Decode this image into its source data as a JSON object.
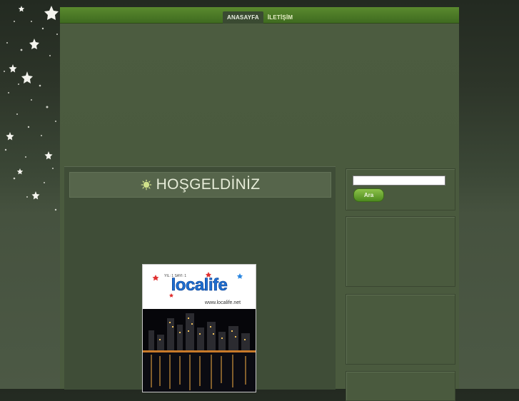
{
  "nav": {
    "items": [
      {
        "label": "ANASAYFA"
      },
      {
        "label": "İLETİŞİM"
      }
    ]
  },
  "content": {
    "title": "HOŞGELDİNİZ"
  },
  "banner": {
    "tagline": "YIL: 1 SAYI: 1",
    "brand": "localife",
    "url": "www.localife.net"
  },
  "sidebar": {
    "search": {
      "value": "",
      "button_label": "Ara"
    }
  },
  "colors": {
    "accent_green": "#5a8a2e",
    "background": "#4a5a3e"
  }
}
